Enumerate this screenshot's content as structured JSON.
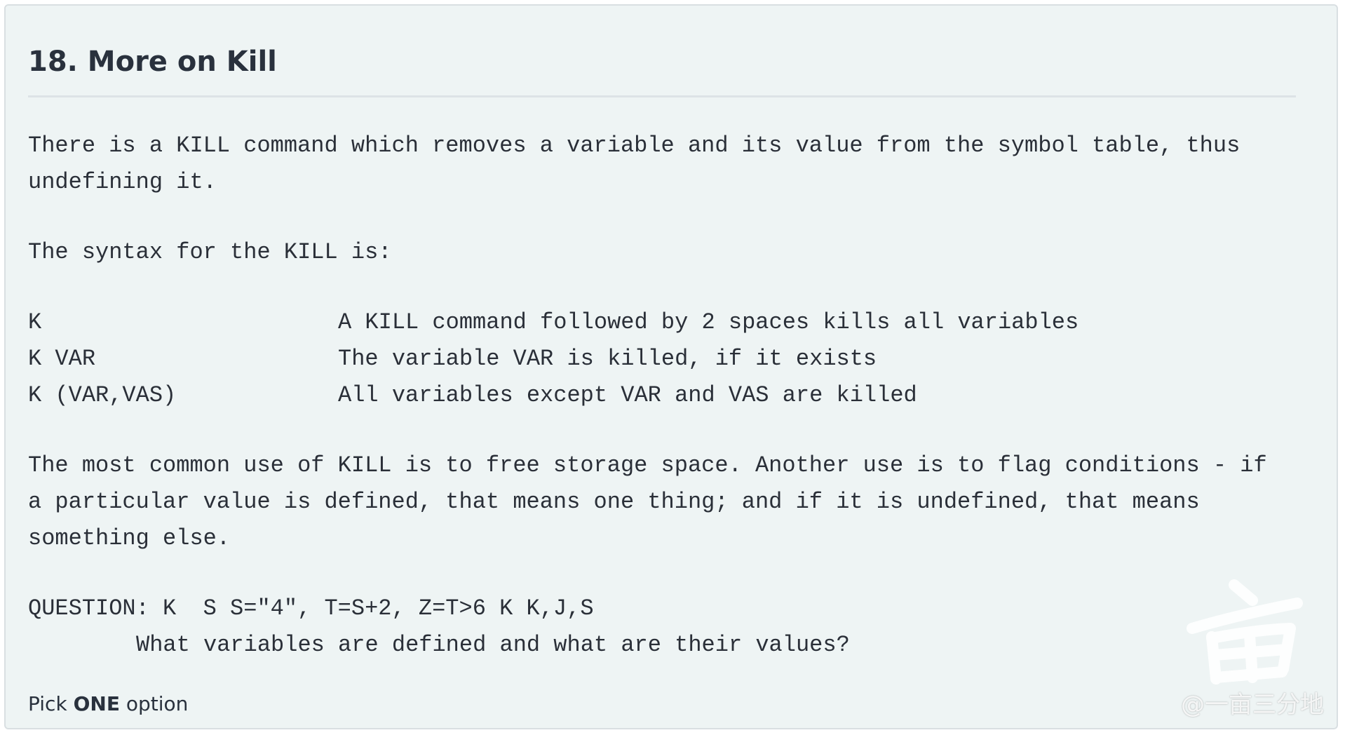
{
  "section": {
    "title": "18. More on Kill"
  },
  "content": {
    "intro_line1": "There is a KILL command which removes a variable and its value from the symbol table, thus",
    "intro_line2": "undefining it.",
    "syntax_heading": "The syntax for the KILL is:",
    "syntax_rows": [
      {
        "command": "K",
        "description": "A KILL command followed by 2 spaces kills all variables"
      },
      {
        "command": "K VAR",
        "description": "The variable VAR is killed, if it exists"
      },
      {
        "command": "K (VAR,VAS)",
        "description": "All variables except VAR and VAS are killed"
      }
    ],
    "usage_line1": "The most common use of KILL is to free storage space. Another use is to flag conditions - if",
    "usage_line2": "a particular value is defined, that means one thing; and if it is undefined, that means",
    "usage_line3": "something else.",
    "question_line1": "QUESTION: K  S S=\"4\", T=S+2, Z=T>6 K K,J,S",
    "question_line2": "What variables are defined and what are their values?"
  },
  "prompt": {
    "pick_prefix": "Pick",
    "pick_emphasis": "ONE",
    "pick_suffix": "option"
  },
  "watermark": {
    "text": "@一亩三分地",
    "icon": "mu-character-logo"
  }
}
